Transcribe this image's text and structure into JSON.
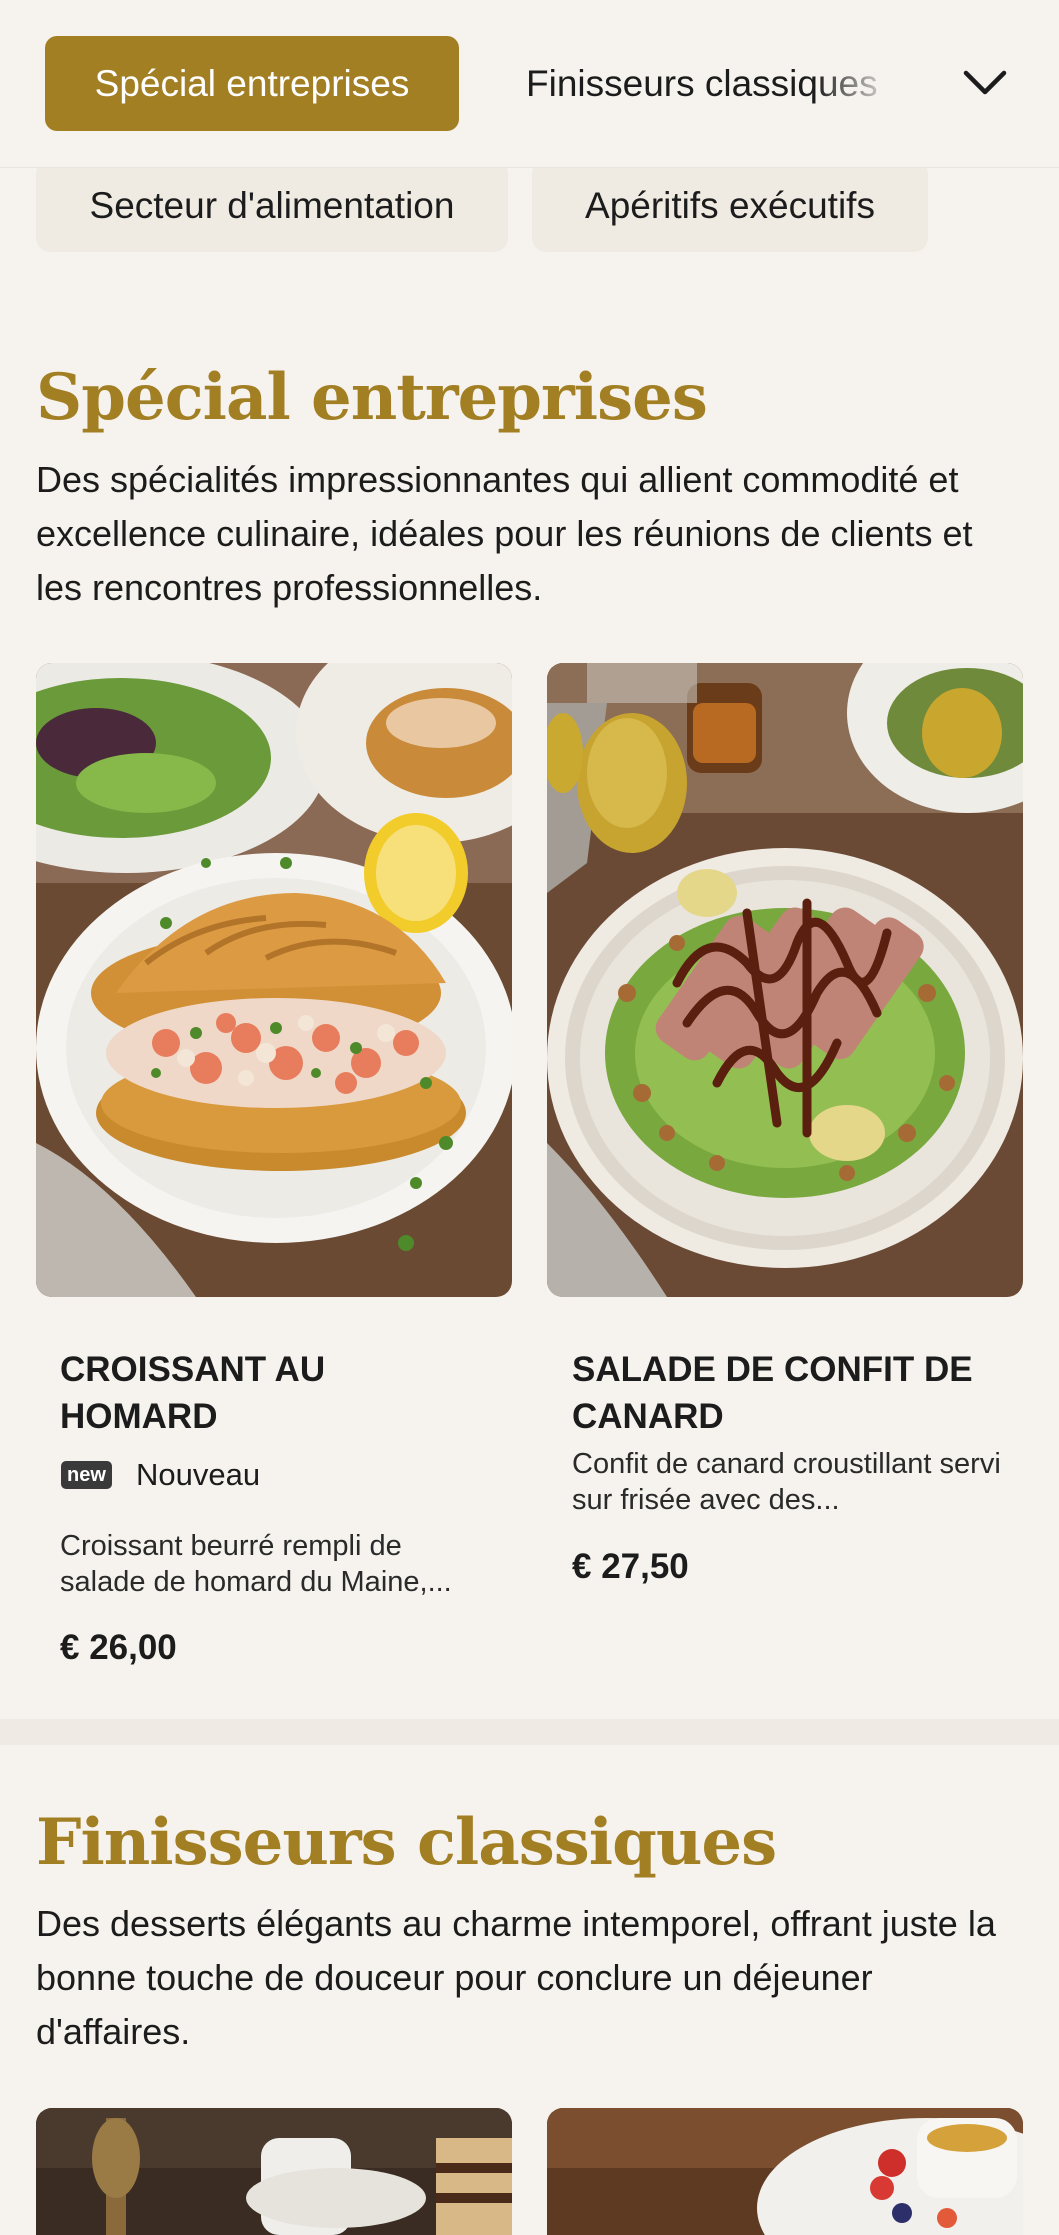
{
  "nav": {
    "active_tab": "Spécial entreprises",
    "next_tab": "Finisseurs classiques",
    "chips": [
      "Secteur d'alimentation",
      "Apéritifs exécutifs"
    ]
  },
  "sections": [
    {
      "title": "Spécial entreprises",
      "description": "Des spécialités impressionnantes qui allient commodité et excellence culinaire, idéales pour les réunions de clients et les rencontres professionnelles.",
      "items": [
        {
          "name": "Croissant au homard",
          "badge_icon": "new",
          "badge_label": "Nouveau",
          "description": "Croissant beurré rempli de salade de homard du Maine,...",
          "price": "€ 26,00"
        },
        {
          "name": "Salade de confit de canard",
          "description": "Confit de canard croustillant servi sur frisée avec des...",
          "price": "€ 27,50"
        }
      ]
    },
    {
      "title": "Finisseurs classiques",
      "description": "Des desserts élégants au charme intemporel, offrant juste la bonne touche de douceur pour conclure un déjeuner d'affaires."
    }
  ],
  "colors": {
    "accent": "#a37f24",
    "background": "#f6f3ee",
    "chip": "#efebe3",
    "text": "#1c1c1c"
  },
  "icons": {
    "expand": "chevron-down-icon",
    "new_badge": "new-badge-icon"
  }
}
